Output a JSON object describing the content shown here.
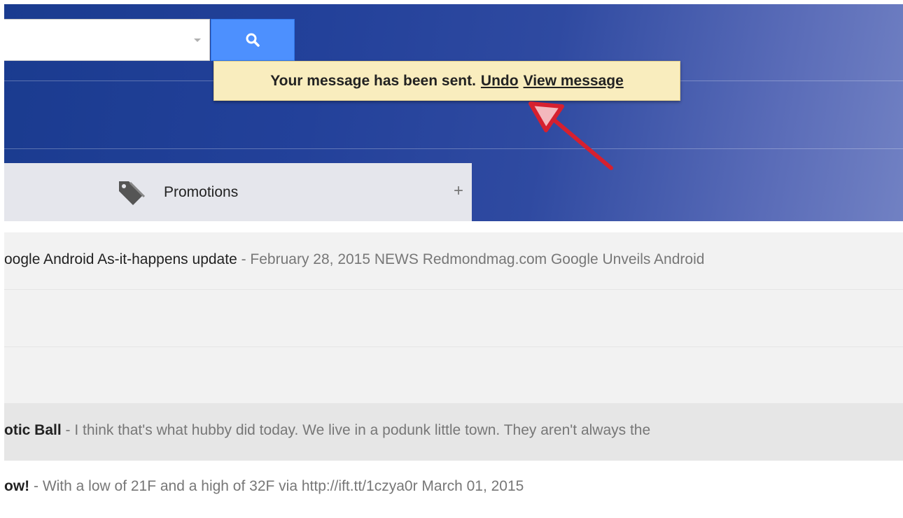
{
  "search": {
    "placeholder": ""
  },
  "toast": {
    "message": "Your message has been sent.",
    "undo_label": "Undo",
    "view_label": "View message"
  },
  "tabs": {
    "promotions_label": "Promotions",
    "add_label": "+"
  },
  "emails": [
    {
      "sender": "",
      "subject": "oogle Android As-it-happens update",
      "snippet": "- February 28, 2015 NEWS Redmondmag.com Google Unveils Android"
    },
    {
      "sender": "",
      "subject": "",
      "snippet": ""
    },
    {
      "sender": "",
      "subject": "",
      "snippet": ""
    },
    {
      "sender": "otic Ball",
      "subject": "",
      "snippet": " - I think that's what hubby did today. We live in a podunk little town. They aren't always the"
    },
    {
      "sender": "ow!",
      "subject": "",
      "snippet": " - With a low of 21F and a high of 32F via http://ift.tt/1czya0r March 01, 2015"
    }
  ],
  "colors": {
    "header_blue": "#23419a",
    "search_button": "#4d90fe",
    "toast_bg": "#f9edbe",
    "annotation_arrow": "#d6202f"
  },
  "icons": [
    "search-icon",
    "tag-icon",
    "annotation-arrow"
  ]
}
